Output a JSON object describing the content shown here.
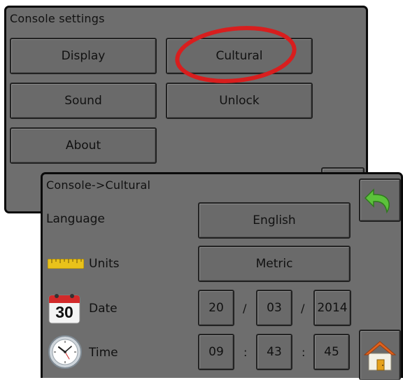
{
  "console_settings": {
    "title": "Console settings",
    "buttons": {
      "display": "Display",
      "cultural": "Cultural",
      "sound": "Sound",
      "unlock": "Unlock",
      "about": "About"
    }
  },
  "cultural": {
    "title": "Console->Cultural",
    "language": {
      "label": "Language",
      "value": "English"
    },
    "units": {
      "label": "Units",
      "value": "Metric",
      "icon": "ruler-icon"
    },
    "date": {
      "label": "Date",
      "day": "20",
      "month": "03",
      "year": "2014",
      "separator": "/",
      "icon": "calendar-icon",
      "icon_text": "30"
    },
    "time": {
      "label": "Time",
      "hour": "09",
      "minute": "43",
      "second": "45",
      "separator": ":",
      "icon": "clock-icon"
    },
    "back_icon": "back-arrow-icon",
    "home_icon": "home-icon"
  },
  "colors": {
    "panel": "#6e6e6e",
    "highlight": "#d81e1e",
    "back_arrow": "#5cc23b",
    "home_roof": "#e0631e"
  }
}
